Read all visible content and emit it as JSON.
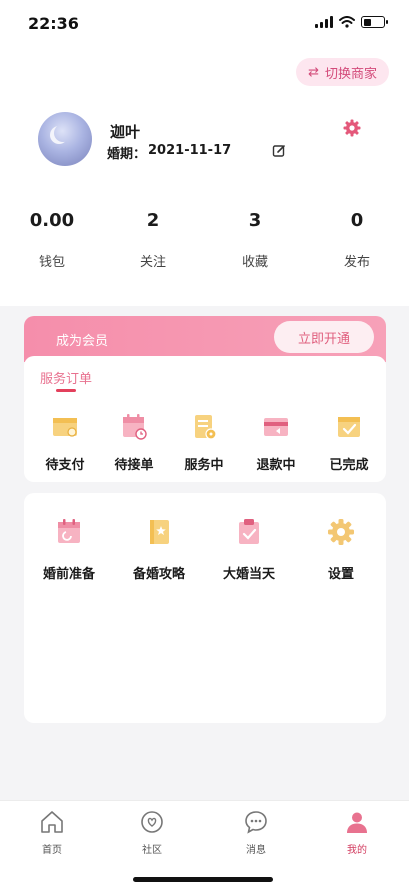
{
  "status": {
    "time": "22:36"
  },
  "header": {
    "switch_label": "切换商家"
  },
  "profile": {
    "name": "迦叶",
    "wedding_label": "婚期：",
    "wedding_date": "2021-11-17"
  },
  "stats": [
    {
      "value": "0.00",
      "label": "钱包"
    },
    {
      "value": "2",
      "label": "关注"
    },
    {
      "value": "3",
      "label": "收藏"
    },
    {
      "value": "0",
      "label": "发布"
    }
  ],
  "member": {
    "title": "成为会员",
    "button": "立即开通"
  },
  "orders": {
    "title": "服务订单",
    "items": [
      {
        "label": "待支付",
        "icon": "wallet-icon"
      },
      {
        "label": "待接单",
        "icon": "calendar-clock-icon"
      },
      {
        "label": "服务中",
        "icon": "document-icon"
      },
      {
        "label": "退款中",
        "icon": "refund-card-icon"
      },
      {
        "label": "已完成",
        "icon": "check-box-icon"
      }
    ]
  },
  "tools": [
    {
      "label": "婚前准备",
      "icon": "calendar-icon"
    },
    {
      "label": "备婚攻略",
      "icon": "guide-book-icon"
    },
    {
      "label": "大婚当天",
      "icon": "clipboard-check-icon"
    },
    {
      "label": "设置",
      "icon": "gear-icon"
    }
  ],
  "tabs": [
    {
      "label": "首页",
      "icon": "home-icon"
    },
    {
      "label": "社区",
      "icon": "community-icon"
    },
    {
      "label": "消息",
      "icon": "chat-icon"
    },
    {
      "label": "我的",
      "icon": "user-icon"
    }
  ],
  "colors": {
    "accent": "#f58eab",
    "active_tab": "#d23b5f"
  }
}
